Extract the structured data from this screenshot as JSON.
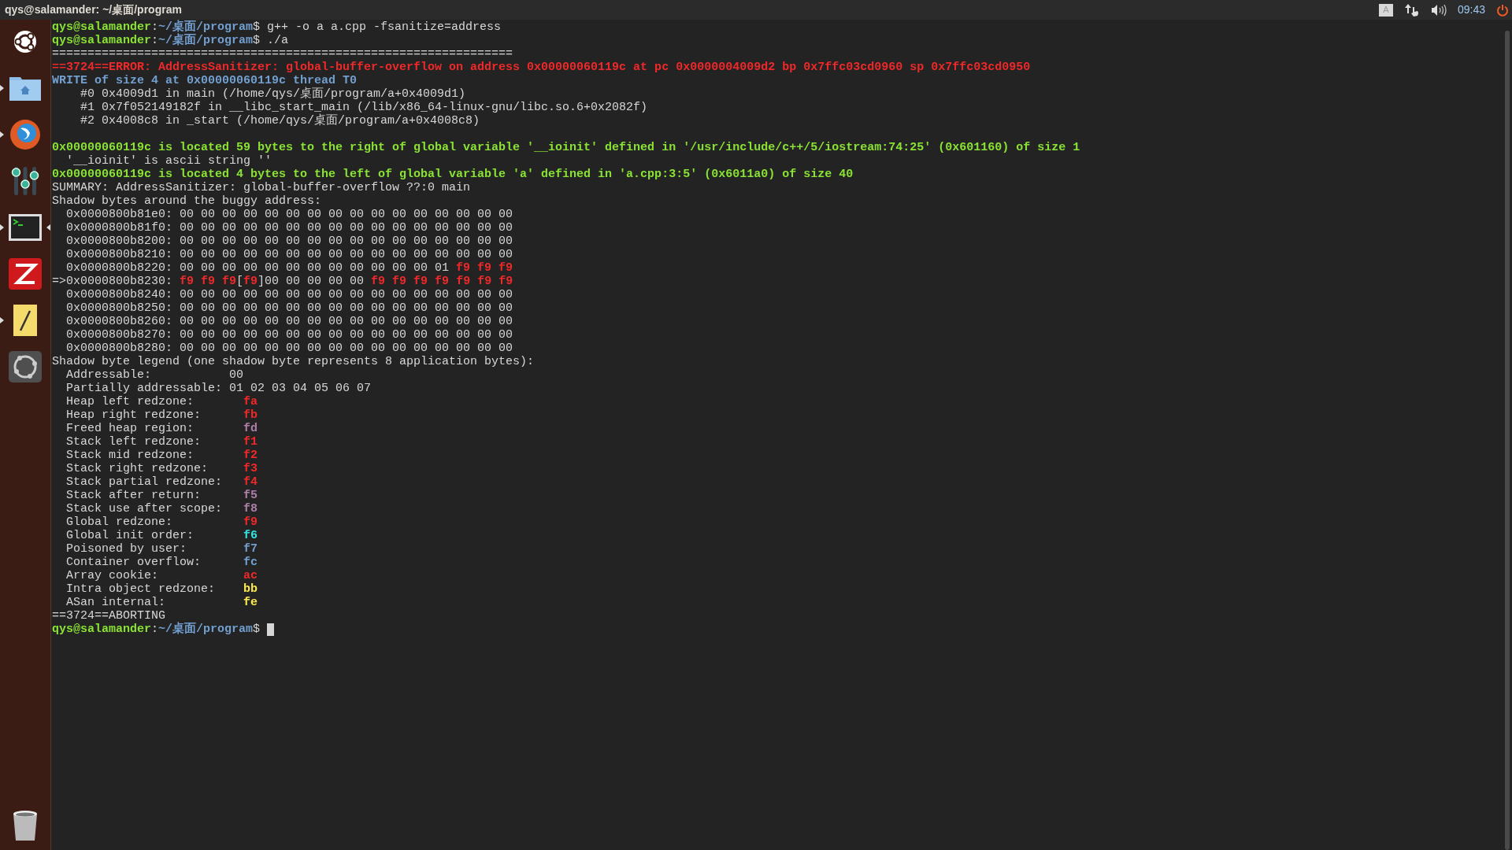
{
  "top_bar": {
    "title": "qys@salamander: ~/桌面/program",
    "keyboard_indicator": "A",
    "clock": "09:43"
  },
  "launcher": {
    "items": [
      {
        "kind": "ubuntu",
        "running": false,
        "focused": false
      },
      {
        "kind": "files",
        "running": true,
        "focused": false
      },
      {
        "kind": "browser",
        "running": true,
        "focused": false
      },
      {
        "kind": "mixer",
        "running": false,
        "focused": false
      },
      {
        "kind": "terminal",
        "running": true,
        "focused": true
      },
      {
        "kind": "ftp",
        "running": false,
        "focused": false
      },
      {
        "kind": "editor",
        "running": true,
        "focused": false
      },
      {
        "kind": "circle",
        "running": false,
        "focused": false
      }
    ],
    "trash": {
      "kind": "trash"
    }
  },
  "terminal": {
    "lines": [
      {
        "kind": "text",
        "segments": [
          {
            "text": "qys@salamander",
            "kind": "user"
          },
          {
            "text": ":",
            "kind": "plain"
          },
          {
            "text": "~/桌面/program",
            "kind": "path"
          },
          {
            "text": "$ g++ -o a a.cpp -fsanitize=address",
            "kind": "plain"
          }
        ]
      },
      {
        "kind": "text",
        "segments": [
          {
            "text": "qys@salamander",
            "kind": "user"
          },
          {
            "text": ":",
            "kind": "plain"
          },
          {
            "text": "~/桌面/program",
            "kind": "path"
          },
          {
            "text": "$ ./a",
            "kind": "plain"
          }
        ]
      },
      {
        "kind": "text",
        "segments": [
          {
            "text": "=================================================================",
            "kind": "plain"
          }
        ]
      },
      {
        "kind": "text",
        "segments": [
          {
            "text": "==3724==ERROR: AddressSanitizer: global-buffer-overflow on address 0x00000060119c at pc 0x0000004009d2 bp 0x7ffc03cd0960 sp 0x7ffc03cd0950",
            "kind": "red"
          }
        ]
      },
      {
        "kind": "text",
        "segments": [
          {
            "text": "WRITE of size 4 at 0x00000060119c thread T0",
            "kind": "blue"
          }
        ]
      },
      {
        "kind": "text",
        "segments": [
          {
            "text": "    #0 0x4009d1 in main (/home/qys/桌面/program/a+0x4009d1)",
            "kind": "plain"
          }
        ]
      },
      {
        "kind": "text",
        "segments": [
          {
            "text": "    #1 0x7f052149182f in __libc_start_main (/lib/x86_64-linux-gnu/libc.so.6+0x2082f)",
            "kind": "plain"
          }
        ]
      },
      {
        "kind": "text",
        "segments": [
          {
            "text": "    #2 0x4008c8 in _start (/home/qys/桌面/program/a+0x4008c8)",
            "kind": "plain"
          }
        ]
      },
      {
        "kind": "blank"
      },
      {
        "kind": "text",
        "segments": [
          {
            "text": "0x00000060119c is located 59 bytes to the right of global variable '__ioinit' defined in '/usr/include/c++/5/iostream:74:25' (0x601160) of size 1",
            "kind": "green"
          }
        ]
      },
      {
        "kind": "text",
        "segments": [
          {
            "text": "  '__ioinit' is ascii string ''",
            "kind": "plain"
          }
        ]
      },
      {
        "kind": "text",
        "segments": [
          {
            "text": "0x00000060119c is located 4 bytes to the left of global variable 'a' defined in 'a.cpp:3:5' (0x6011a0) of size 40",
            "kind": "green"
          }
        ]
      },
      {
        "kind": "text",
        "segments": [
          {
            "text": "SUMMARY: AddressSanitizer: global-buffer-overflow ??:0 main",
            "kind": "plain"
          }
        ]
      },
      {
        "kind": "text",
        "segments": [
          {
            "text": "Shadow bytes around the buggy address:",
            "kind": "plain"
          }
        ]
      },
      {
        "kind": "text",
        "segments": [
          {
            "text": "  0x0000800b81e0: 00 00 00 00 00 00 00 00 00 00 00 00 00 00 00 00",
            "kind": "plain"
          }
        ]
      },
      {
        "kind": "text",
        "segments": [
          {
            "text": "  0x0000800b81f0: 00 00 00 00 00 00 00 00 00 00 00 00 00 00 00 00",
            "kind": "plain"
          }
        ]
      },
      {
        "kind": "text",
        "segments": [
          {
            "text": "  0x0000800b8200: 00 00 00 00 00 00 00 00 00 00 00 00 00 00 00 00",
            "kind": "plain"
          }
        ]
      },
      {
        "kind": "text",
        "segments": [
          {
            "text": "  0x0000800b8210: 00 00 00 00 00 00 00 00 00 00 00 00 00 00 00 00",
            "kind": "plain"
          }
        ]
      },
      {
        "kind": "text",
        "segments": [
          {
            "text": "  0x0000800b8220: 00 00 00 00 00 00 00 00 00 00 00 00 01 ",
            "kind": "plain"
          },
          {
            "text": "f9 f9 f9",
            "kind": "red"
          }
        ]
      },
      {
        "kind": "text",
        "segments": [
          {
            "text": "=>0x0000800b8230: ",
            "kind": "plain"
          },
          {
            "text": "f9 f9 f9",
            "kind": "red"
          },
          {
            "text": "[",
            "kind": "plain"
          },
          {
            "text": "f9",
            "kind": "red"
          },
          {
            "text": "]00 00 00 00 00 ",
            "kind": "plain"
          },
          {
            "text": "f9 f9 f9 f9 f9 f9 f9",
            "kind": "red"
          }
        ]
      },
      {
        "kind": "text",
        "segments": [
          {
            "text": "  0x0000800b8240: 00 00 00 00 00 00 00 00 00 00 00 00 00 00 00 00",
            "kind": "plain"
          }
        ]
      },
      {
        "kind": "text",
        "segments": [
          {
            "text": "  0x0000800b8250: 00 00 00 00 00 00 00 00 00 00 00 00 00 00 00 00",
            "kind": "plain"
          }
        ]
      },
      {
        "kind": "text",
        "segments": [
          {
            "text": "  0x0000800b8260: 00 00 00 00 00 00 00 00 00 00 00 00 00 00 00 00",
            "kind": "plain"
          }
        ]
      },
      {
        "kind": "text",
        "segments": [
          {
            "text": "  0x0000800b8270: 00 00 00 00 00 00 00 00 00 00 00 00 00 00 00 00",
            "kind": "plain"
          }
        ]
      },
      {
        "kind": "text",
        "segments": [
          {
            "text": "  0x0000800b8280: 00 00 00 00 00 00 00 00 00 00 00 00 00 00 00 00",
            "kind": "plain"
          }
        ]
      },
      {
        "kind": "text",
        "segments": [
          {
            "text": "Shadow byte legend (one shadow byte represents 8 application bytes):",
            "kind": "plain"
          }
        ]
      },
      {
        "kind": "text",
        "segments": [
          {
            "text": "  Addressable:           00",
            "kind": "plain"
          }
        ]
      },
      {
        "kind": "text",
        "segments": [
          {
            "text": "  Partially addressable: 01 02 03 04 05 06 07",
            "kind": "plain"
          }
        ]
      },
      {
        "kind": "text",
        "segments": [
          {
            "text": "  Heap left redzone:       ",
            "kind": "plain"
          },
          {
            "text": "fa",
            "kind": "red"
          }
        ]
      },
      {
        "kind": "text",
        "segments": [
          {
            "text": "  Heap right redzone:      ",
            "kind": "plain"
          },
          {
            "text": "fb",
            "kind": "red"
          }
        ]
      },
      {
        "kind": "text",
        "segments": [
          {
            "text": "  Freed heap region:       ",
            "kind": "plain"
          },
          {
            "text": "fd",
            "kind": "purple"
          }
        ]
      },
      {
        "kind": "text",
        "segments": [
          {
            "text": "  Stack left redzone:      ",
            "kind": "plain"
          },
          {
            "text": "f1",
            "kind": "red"
          }
        ]
      },
      {
        "kind": "text",
        "segments": [
          {
            "text": "  Stack mid redzone:       ",
            "kind": "plain"
          },
          {
            "text": "f2",
            "kind": "red"
          }
        ]
      },
      {
        "kind": "text",
        "segments": [
          {
            "text": "  Stack right redzone:     ",
            "kind": "plain"
          },
          {
            "text": "f3",
            "kind": "red"
          }
        ]
      },
      {
        "kind": "text",
        "segments": [
          {
            "text": "  Stack partial redzone:   ",
            "kind": "plain"
          },
          {
            "text": "f4",
            "kind": "red"
          }
        ]
      },
      {
        "kind": "text",
        "segments": [
          {
            "text": "  Stack after return:      ",
            "kind": "plain"
          },
          {
            "text": "f5",
            "kind": "purple"
          }
        ]
      },
      {
        "kind": "text",
        "segments": [
          {
            "text": "  Stack use after scope:   ",
            "kind": "plain"
          },
          {
            "text": "f8",
            "kind": "purple"
          }
        ]
      },
      {
        "kind": "text",
        "segments": [
          {
            "text": "  Global redzone:          ",
            "kind": "plain"
          },
          {
            "text": "f9",
            "kind": "red"
          }
        ]
      },
      {
        "kind": "text",
        "segments": [
          {
            "text": "  Global init order:       ",
            "kind": "plain"
          },
          {
            "text": "f6",
            "kind": "cyan"
          }
        ]
      },
      {
        "kind": "text",
        "segments": [
          {
            "text": "  Poisoned by user:        ",
            "kind": "plain"
          },
          {
            "text": "f7",
            "kind": "blue"
          }
        ]
      },
      {
        "kind": "text",
        "segments": [
          {
            "text": "  Container overflow:      ",
            "kind": "plain"
          },
          {
            "text": "fc",
            "kind": "blue"
          }
        ]
      },
      {
        "kind": "text",
        "segments": [
          {
            "text": "  Array cookie:            ",
            "kind": "plain"
          },
          {
            "text": "ac",
            "kind": "red"
          }
        ]
      },
      {
        "kind": "text",
        "segments": [
          {
            "text": "  Intra object redzone:    ",
            "kind": "plain"
          },
          {
            "text": "bb",
            "kind": "yellow"
          }
        ]
      },
      {
        "kind": "text",
        "segments": [
          {
            "text": "  ASan internal:           ",
            "kind": "plain"
          },
          {
            "text": "fe",
            "kind": "yellow"
          }
        ]
      },
      {
        "kind": "text",
        "segments": [
          {
            "text": "==3724==ABORTING",
            "kind": "plain"
          }
        ]
      },
      {
        "kind": "text",
        "segments": [
          {
            "text": "qys@salamander",
            "kind": "user"
          },
          {
            "text": ":",
            "kind": "plain"
          },
          {
            "text": "~/桌面/program",
            "kind": "path"
          },
          {
            "text": "$ ",
            "kind": "plain"
          }
        ],
        "cursor": true
      }
    ]
  }
}
